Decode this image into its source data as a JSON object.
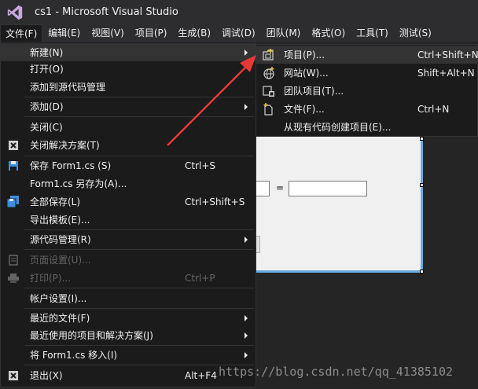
{
  "window": {
    "title": "cs1 - Microsoft Visual Studio"
  },
  "menubar": [
    "文件(F)",
    "编辑(E)",
    "视图(V)",
    "项目(P)",
    "生成(B)",
    "调试(D)",
    "团队(M)",
    "格式(O)",
    "工具(T)",
    "测试(S)"
  ],
  "designer": {
    "equals": "="
  },
  "file_menu": {
    "new": "新建(N)",
    "open": "打开(O)",
    "add_to_source_control": "添加到源代码管理",
    "add": "添加(D)",
    "close": "关闭(C)",
    "close_solution": "关闭解决方案(T)",
    "save": "保存 Form1.cs (S)",
    "save_shortcut": "Ctrl+S",
    "save_as": "Form1.cs 另存为(A)...",
    "save_all": "全部保存(L)",
    "save_all_shortcut": "Ctrl+Shift+S",
    "export_template": "导出模板(E)...",
    "source_control": "源代码管理(R)",
    "page_setup": "页面设置(U)...",
    "print": "打印(P)...",
    "print_shortcut": "Ctrl+P",
    "account_settings": "帐户设置(I)...",
    "recent_files": "最近的文件(F)",
    "recent_projects": "最近使用的项目和解决方案(J)",
    "move_form": "将 Form1.cs 移入(I)",
    "exit": "退出(X)",
    "exit_shortcut": "Alt+F4"
  },
  "new_menu": {
    "project": "项目(P)...",
    "project_shortcut": "Ctrl+Shift+N",
    "website": "网站(W)...",
    "website_shortcut": "Shift+Alt+N",
    "team_project": "团队项目(T)...",
    "file": "文件(F)...",
    "file_shortcut": "Ctrl+N",
    "from_existing_code": "从现有代码创建项目(E)..."
  },
  "watermark": "https://blog.csdn.net/qq_41385102",
  "colors": {
    "accent": "#68217a",
    "arrow": "#e53935",
    "highlight": "#333334",
    "menu_bg": "#1b1b1c"
  }
}
